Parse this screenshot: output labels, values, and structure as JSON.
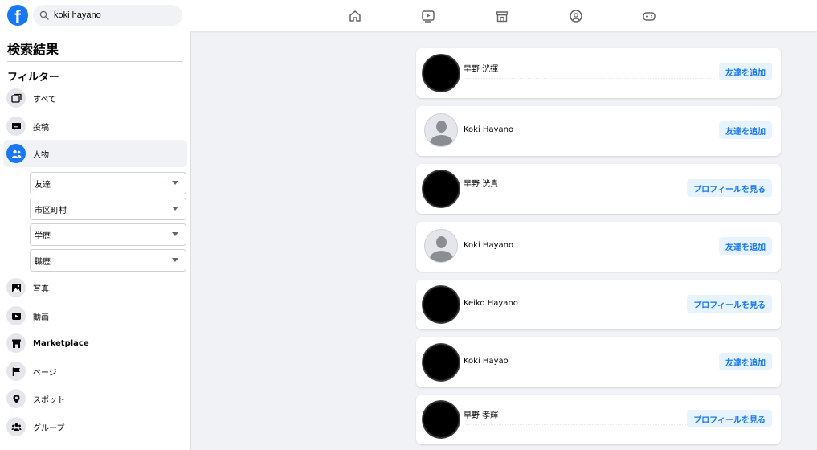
{
  "topbar": {
    "logo_letter": "f",
    "search_value": "koki hayano",
    "nav": [
      "home-icon",
      "watch-icon",
      "marketplace-icon",
      "groups-icon",
      "gaming-icon"
    ]
  },
  "sidebar": {
    "title": "検索結果",
    "filter_heading": "フィルター",
    "items": [
      {
        "label": "すべて",
        "icon": "all-icon"
      },
      {
        "label": "投稿",
        "icon": "posts-icon"
      },
      {
        "label": "人物",
        "icon": "people-icon",
        "active": true
      },
      {
        "label": "写真",
        "icon": "photos-icon"
      },
      {
        "label": "動画",
        "icon": "videos-icon"
      },
      {
        "label": "Marketplace",
        "icon": "marketplace-icon"
      },
      {
        "label": "ページ",
        "icon": "pages-icon"
      },
      {
        "label": "スポット",
        "icon": "places-icon"
      },
      {
        "label": "グループ",
        "icon": "groups-icon"
      }
    ],
    "people_filters": [
      "友達",
      "市区町村",
      "学歴",
      "職歴"
    ]
  },
  "results": [
    {
      "name": "早野 洸揮",
      "avatar": "redacted",
      "action": "友達を追加"
    },
    {
      "name": "Koki Hayano",
      "avatar": "default",
      "action": "友達を追加"
    },
    {
      "name": "早野 洸貴",
      "avatar": "redacted",
      "action": "プロフィールを見る"
    },
    {
      "name": "Koki Hayano",
      "avatar": "default",
      "action": "友達を追加"
    },
    {
      "name": "Keiko Hayano",
      "avatar": "redacted",
      "action": "プロフィールを見る"
    },
    {
      "name": "Koki Hayao",
      "avatar": "redacted",
      "action": "友達を追加"
    },
    {
      "name": "早野 孝輝",
      "avatar": "redacted",
      "action": "プロフィールを見る"
    }
  ],
  "colors": {
    "brand": "#1877f2",
    "button_bg": "#e7f3ff",
    "page_bg": "#f0f2f5"
  }
}
